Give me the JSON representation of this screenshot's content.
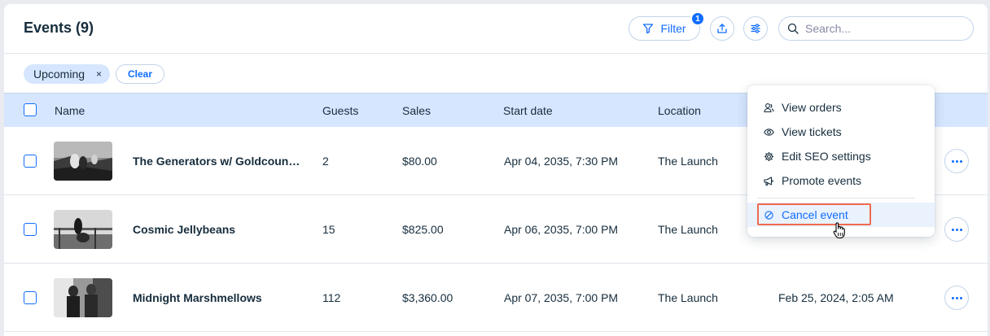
{
  "header": {
    "title": "Events (9)",
    "filter_label": "Filter",
    "filter_badge": "1",
    "search_placeholder": "Search..."
  },
  "filters": {
    "chip_label": "Upcoming",
    "chip_remove": "×",
    "clear_label": "Clear"
  },
  "table": {
    "columns": [
      "Name",
      "Guests",
      "Sales",
      "Start date",
      "Location"
    ],
    "rows": [
      {
        "name": "The Generators w/ Goldcoun…",
        "guests": "2",
        "sales": "$80.00",
        "start_date": "Apr 04, 2035, 7:30 PM",
        "location": "The Launch",
        "extra": ""
      },
      {
        "name": "Cosmic Jellybeans",
        "guests": "15",
        "sales": "$825.00",
        "start_date": "Apr 06, 2035, 7:00 PM",
        "location": "The Launch",
        "extra": ""
      },
      {
        "name": "Midnight Marshmellows",
        "guests": "112",
        "sales": "$3,360.00",
        "start_date": "Apr 07, 2035, 7:00 PM",
        "location": "The Launch",
        "extra": "Feb 25, 2024, 2:05 AM"
      }
    ]
  },
  "menu": {
    "items": [
      "View orders",
      "View tickets",
      "Edit SEO settings",
      "Promote events"
    ],
    "cancel": "Cancel event"
  },
  "colors": {
    "accent": "#116dff",
    "header_row": "#d6e6fe",
    "highlight": "#ef6a4f",
    "text": "#162d3d"
  }
}
